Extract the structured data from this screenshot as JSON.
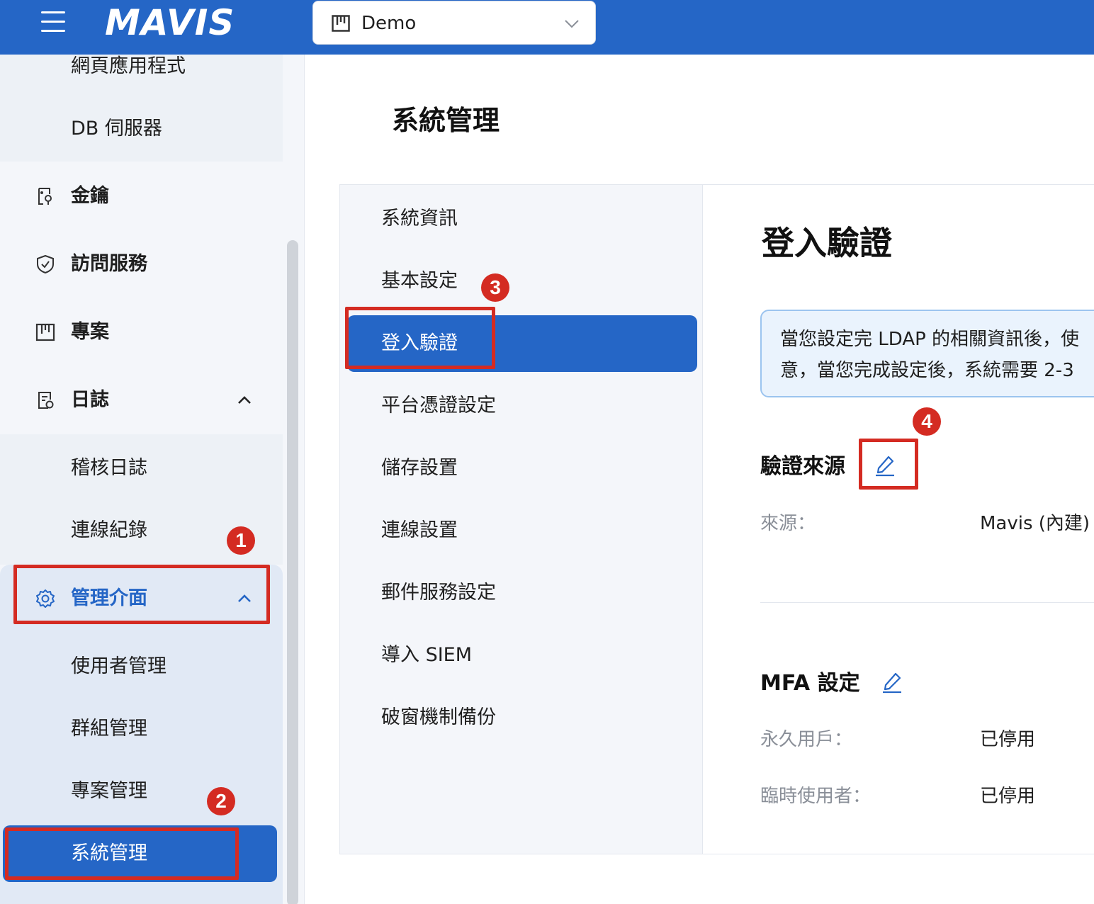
{
  "header": {
    "logo_text": "MAVIS",
    "project_select": {
      "value": "Demo"
    },
    "hamburger_icon": "menu-icon",
    "chevron_icon": "chevron-down-icon"
  },
  "sidebar": {
    "items": [
      {
        "label": "網頁應用程式",
        "type": "subitem"
      },
      {
        "label": "DB 伺服器",
        "type": "subitem"
      },
      {
        "label": "金鑰",
        "icon": "key-icon",
        "type": "parent"
      },
      {
        "label": "訪問服務",
        "icon": "shield-icon",
        "type": "parent"
      },
      {
        "label": "專案",
        "icon": "project-icon",
        "type": "parent"
      },
      {
        "label": "日誌",
        "icon": "log-icon",
        "type": "parent",
        "expanded": true
      },
      {
        "label": "稽核日誌",
        "type": "subitem"
      },
      {
        "label": "連線紀錄",
        "type": "subitem"
      },
      {
        "label": "管理介面",
        "icon": "gear-icon",
        "type": "parent",
        "expanded": true,
        "active": true
      },
      {
        "label": "使用者管理",
        "type": "subitem"
      },
      {
        "label": "群組管理",
        "type": "subitem"
      },
      {
        "label": "專案管理",
        "type": "subitem"
      },
      {
        "label": "系統管理",
        "type": "subitem",
        "selected": true
      }
    ]
  },
  "main": {
    "page_title": "系統管理",
    "subnav": [
      {
        "label": "系統資訊"
      },
      {
        "label": "基本設定"
      },
      {
        "label": "登入驗證",
        "selected": true
      },
      {
        "label": "平台憑證設定"
      },
      {
        "label": "儲存設置"
      },
      {
        "label": "連線設置"
      },
      {
        "label": "郵件服務設定"
      },
      {
        "label": "導入 SIEM"
      },
      {
        "label": "破窗機制備份"
      }
    ],
    "content": {
      "title": "登入驗證",
      "info_line1": "當您設定完 LDAP 的相關資訊後，使",
      "info_line2": "意，當您完成設定後，系統需要 2-3",
      "auth_source": {
        "heading": "驗證來源",
        "key": "來源：",
        "value": "Mavis (內建)"
      },
      "mfa": {
        "heading": "MFA 設定",
        "permanent_key": "永久用戶：",
        "permanent_value": "已停用",
        "temp_key": "臨時使用者：",
        "temp_value": "已停用"
      }
    }
  },
  "annotations": {
    "badges": [
      "1",
      "2",
      "3",
      "4"
    ],
    "color": "#d42b22"
  },
  "colors": {
    "brand": "#2566c6",
    "sidebar_bg": "#f4f6fa",
    "info_bg": "#eaf3fd",
    "annotation": "#d42b22"
  }
}
